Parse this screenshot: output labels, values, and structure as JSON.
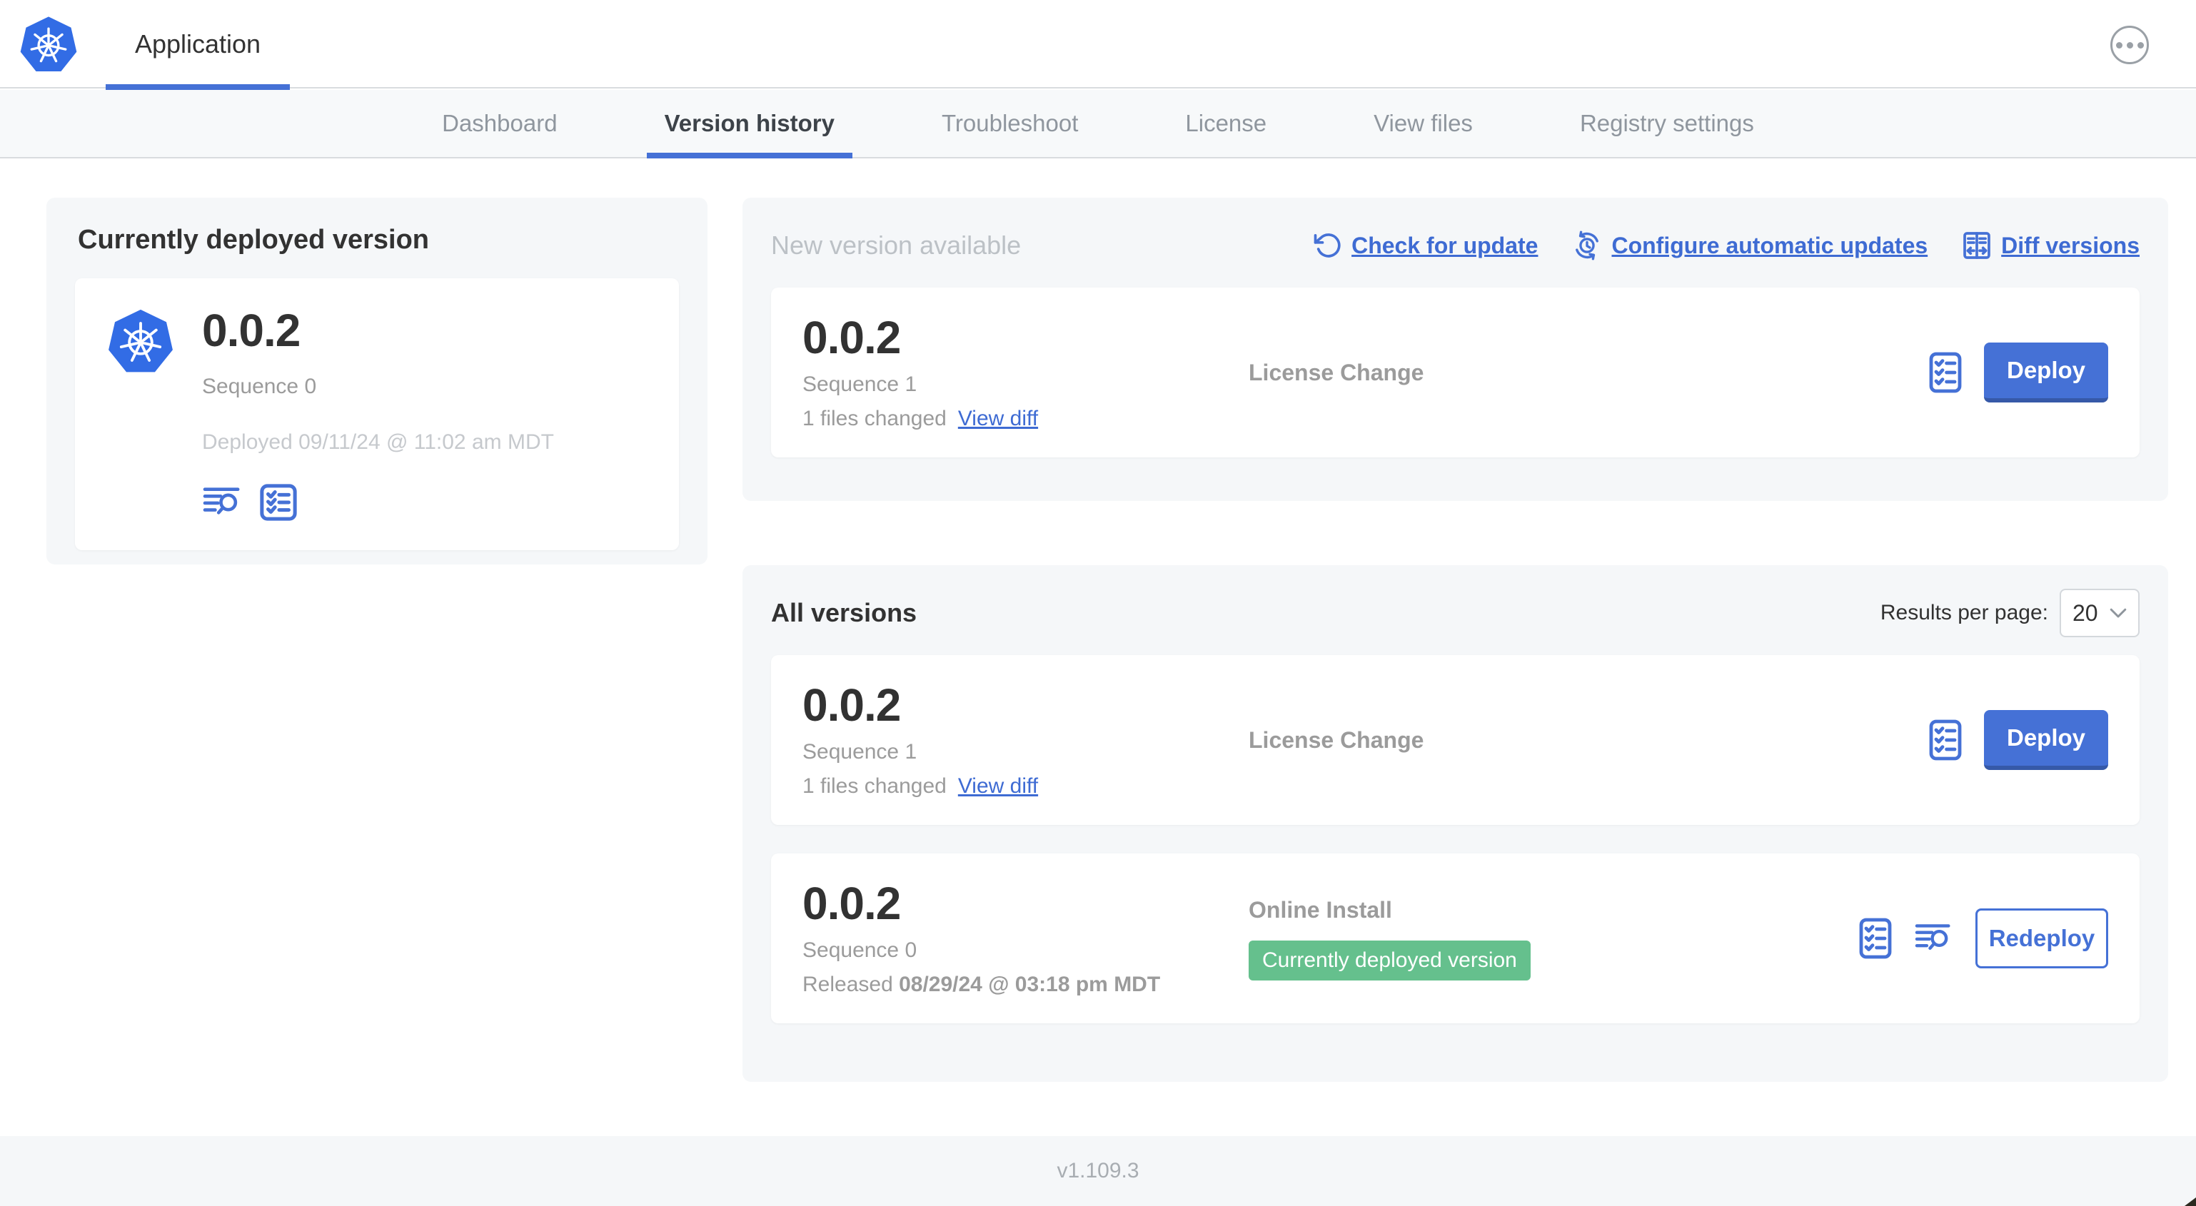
{
  "colors": {
    "accent_blue": "#4571d6",
    "link_blue": "#3e6bd3",
    "badge_green": "#65c08d",
    "panel_gray": "#f5f7f9",
    "text_dark": "#323232",
    "text_gray": "#9b9b9b",
    "text_faint": "#c6c9cd"
  },
  "topbar": {
    "app_label": "Application",
    "logo_icon": "kubernetes-logo",
    "menu_icon": "ellipsis-circle"
  },
  "nav": {
    "tabs": [
      {
        "label": "Dashboard"
      },
      {
        "label": "Version history"
      },
      {
        "label": "Troubleshoot"
      },
      {
        "label": "License"
      },
      {
        "label": "View files"
      },
      {
        "label": "Registry settings"
      }
    ],
    "active_tab": "Version history"
  },
  "deployed_panel": {
    "title": "Currently deployed version",
    "version": "0.0.2",
    "sequence": "Sequence 0",
    "deployed_at": "Deployed 09/11/24 @ 11:02 am MDT",
    "icons": [
      "deploy-logs-icon",
      "preflight-checks-icon"
    ]
  },
  "new_version_section": {
    "heading": "New version available",
    "links": [
      {
        "label": "Check for update",
        "icon": "refresh-ccw-icon"
      },
      {
        "label": "Configure automatic updates",
        "icon": "auto-update-clock-icon"
      },
      {
        "label": "Diff versions",
        "icon": "diff-icon"
      }
    ],
    "card": {
      "version": "0.0.2",
      "sequence": "Sequence 1",
      "files_changed": "1 files changed",
      "view_diff_label": "View diff",
      "source": "License Change",
      "action_label": "Deploy"
    }
  },
  "all_versions_section": {
    "heading": "All versions",
    "results_per_page_label": "Results per page:",
    "results_per_page_value": "20",
    "rows": [
      {
        "version": "0.0.2",
        "sequence": "Sequence 1",
        "files_changed": "1 files changed",
        "view_diff_label": "View diff",
        "source": "License Change",
        "action_label": "Deploy"
      },
      {
        "version": "0.0.2",
        "sequence": "Sequence 0",
        "released_prefix": "Released ",
        "released_date": "08/29/24 @ 03:18 pm MDT",
        "source": "Online Install",
        "badge": "Currently deployed version",
        "action_label": "Redeploy"
      }
    ]
  },
  "footer": {
    "version": "v1.109.3"
  }
}
